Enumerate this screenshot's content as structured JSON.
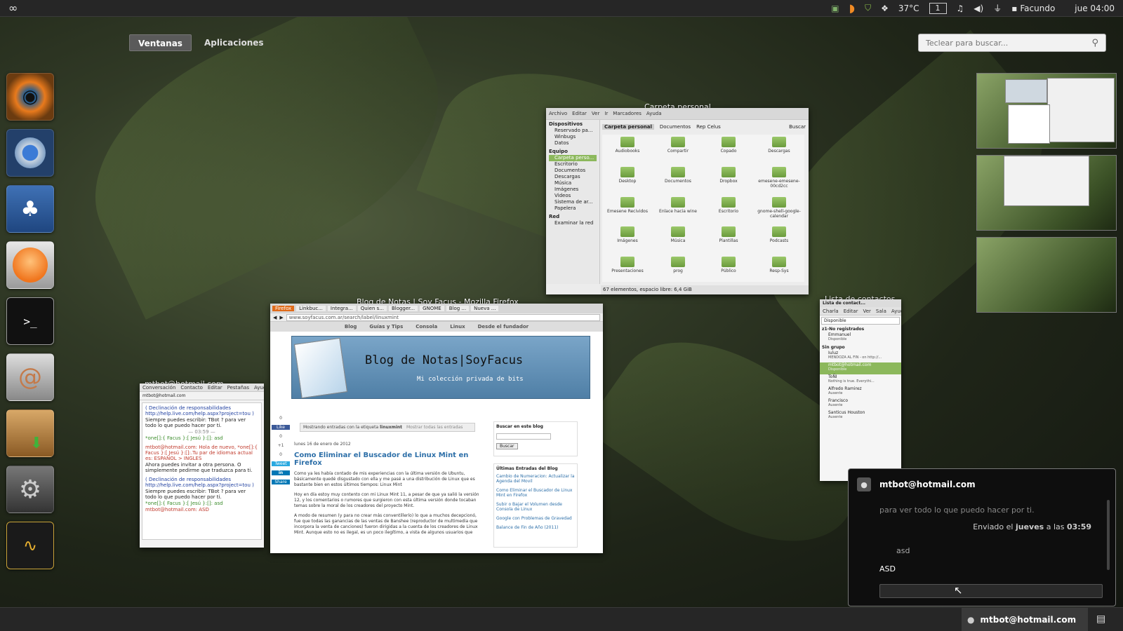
{
  "topbar": {
    "temperature": "37°C",
    "workspace": "1",
    "user": "Facundo",
    "clock": "jue 04:00",
    "icons": [
      "activities-icon",
      "update-icon",
      "weather-icon",
      "shield-icon",
      "dropbox-icon",
      "music-icon",
      "volume-icon",
      "network-icon",
      "chat-icon"
    ]
  },
  "overview": {
    "tab_windows": "Ventanas",
    "tab_apps": "Aplicaciones"
  },
  "search": {
    "placeholder": "Teclear para buscar..."
  },
  "dock": [
    "eye-of-gnome-icon",
    "chromium-icon",
    "gnome-foot-icon",
    "clementine-icon",
    "terminal-icon",
    "nautilus-shell-icon",
    "package-installer-icon",
    "system-settings-icon",
    "system-monitor-icon"
  ],
  "file_manager": {
    "caption": "Carpeta personal",
    "menu": [
      "Archivo",
      "Editar",
      "Ver",
      "Ir",
      "Marcadores",
      "Ayuda"
    ],
    "sidebar_sections": [
      {
        "title": "Dispositivos",
        "items": [
          "Reservado pa...",
          "Winbugs",
          "Datos"
        ]
      },
      {
        "title": "Equipo",
        "items": [
          "Carpeta perso...",
          "Escritorio",
          "Documentos",
          "Descargas",
          "Música",
          "Imágenes",
          "Videos",
          "Sistema de ar...",
          "Papelera"
        ]
      },
      {
        "title": "Red",
        "items": [
          "Examinar la red"
        ]
      }
    ],
    "path": [
      "Carpeta personal",
      "Documentos",
      "Rep Celus"
    ],
    "search_label": "Buscar",
    "folders": [
      "Audiobooks",
      "Compartir",
      "Copado",
      "Descargas",
      "Desktop",
      "Documentos",
      "Dropbox",
      "emesene-emesene-00cd2cc",
      "Emesene Recividos",
      "Enlace hacia wine",
      "Escritorio",
      "gnome-shell-google-calendar",
      "Imágenes",
      "Música",
      "Plantillas",
      "Podcasts",
      "Presentaciones",
      "prog",
      "Público",
      "Resp-Sys"
    ],
    "status": "67 elementos, espacio libre: 6,4 GiB"
  },
  "firefox": {
    "caption": "Blog de Notas | Soy Facus - Mozilla Firefox",
    "tabs": [
      "Firefox",
      "Linkbuc...",
      "Integra...",
      "Quien s...",
      "Blogger...",
      "GNOME",
      "Blog ...",
      "Nueva ..."
    ],
    "url": "www.soyfacus.com.ar/search/label/linuxmint",
    "nav": [
      "Blog",
      "Guías y Tips",
      "Consola",
      "Linux",
      "Desde el fundador"
    ],
    "blog_title": "Blog de Notas|SoyFacus",
    "blog_subtitle": "Mi colección privada de bits",
    "filter_prefix": "Mostrando entradas con la etiqueta",
    "filter_label": "linuxmint",
    "filter_link": "Mostrar todas las entradas",
    "post_date": "lunes 16 de enero de 2012",
    "post_title": "Como Eliminar el Buscador de Linux Mint en Firefox",
    "post_p1": "Como ya les había contado de mis experiencias con la última versión de Ubuntu, básicamente quedé disgustado con ella y me pasé a una distribución de Linux que es bastante bien en estos últimos tiempos: Linux Mint",
    "post_p2": "Hoy en día estoy muy contento con mi Linux Mint 11, a pesar de que ya salió la versión 12, y los comentarios o rumores que surgieron con esta última versión donde tocaban temas sobre la moral de los creadores del proyecto Mint.",
    "post_p3": "A modo de resumen (y para no crear más conventillerío) lo que a muchos decepcionó, fue que todas las ganancias de las ventas de Banshee (reproductor de multimedia que incorpora la venta de canciones) fueron dirigidas a la cuenta de los creadores de Linux Mint. Aunque esto no es ilegal, es un poco ilegítimo, a vista de algunos usuarios que",
    "search_box_title": "Buscar en este blog",
    "search_btn": "Buscar",
    "recent_title": "Últimas Entradas del Blog",
    "recent": [
      "Cambio de Numeracion: Actualizar la Agenda del Movil",
      "Como Eliminar el Buscador de Linux Mint en Firefox",
      "Subir o Bajar el Volumen desde Consola de Linux",
      "Google con Problemas de Gravedad",
      "Balance de Fin de Año (2011)"
    ],
    "social": [
      "0",
      "Like",
      "0",
      "+1",
      "0",
      "Tweet",
      "in",
      "Share"
    ]
  },
  "msn_window": {
    "caption": "mtbot@hotmail.com",
    "menu": [
      "Conversación",
      "Contacto",
      "Editar",
      "Pestañas",
      "Ayuda"
    ],
    "tab": "mtbot@hotmail.com",
    "lines": [
      "( Declinación de responsabilidades http://help.live.com/help.aspx?project=tou )",
      "Siempre puedes escribir: TBot ? para ver todo lo que puedo hacer por ti.",
      "— 03:59 —",
      "*one[]:{ Facus }:[ Jesú }:[]: asd",
      "mtbot@hotmail.com: Hola de nuevo, *one[]:{ Facus }:[ Jesú }:[]:.Tu par de idiomas actual es: ESPAÑOL > INGLES",
      "Ahora puedes invitar a otra persona. O simplemente pedirme que traduzca para ti.",
      "( Declinación de responsabilidades http://help.live.com/help.aspx?project=tou )",
      "Siempre puedes escribir: TBot ? para ver todo lo que puedo hacer por ti.",
      "*one[]:{ Facus }:[ Jesú }:[]: asd",
      "mtbot@hotmail.com: ASD"
    ]
  },
  "contacts": {
    "caption": "Lista de contactos",
    "title": "Lista de contact...",
    "menu": [
      "Charla",
      "Editar",
      "Ver",
      "Sala",
      "Ayuda"
    ],
    "status": "Disponible",
    "groups": [
      {
        "title": "z1-No registrados",
        "items": [
          {
            "name": "Emmanuel",
            "status": "Disponible"
          }
        ]
      },
      {
        "title": "Sin grupo",
        "items": [
          {
            "name": "Iuluz",
            "status": "MENDOZA AL FIN - on http://..."
          },
          {
            "name": "mtbot@hotmail.com",
            "status": "Disponible"
          },
          {
            "name": "ToÑI",
            "status": "Nothing is true. Everythi..."
          },
          {
            "name": "Alfredo Ramirez",
            "status": "Ausente"
          },
          {
            "name": "Francisco",
            "status": "Ausente"
          },
          {
            "name": "Santicus Houston",
            "status": "Ausente"
          }
        ]
      }
    ]
  },
  "chat_popup": {
    "title": "mtbot@hotmail.com",
    "faded": "para ver todo lo que puedo hacer por ti.",
    "sent_prefix": "Enviado el",
    "sent_day": "jueves",
    "sent_mid": "a las",
    "sent_time": "03:59",
    "msg1": "asd",
    "msg2": "ASD"
  },
  "bottombar": {
    "notification": "mtbot@hotmail.com"
  }
}
